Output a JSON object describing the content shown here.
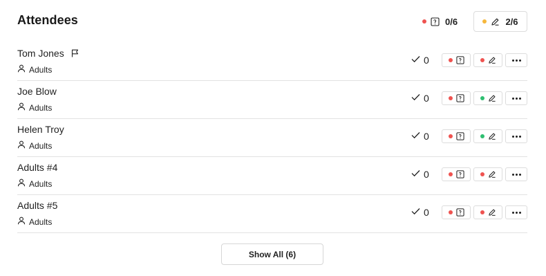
{
  "header": {
    "title": "Attendees",
    "forms_summary": {
      "count": "0/6",
      "status": "red",
      "icon": "form-icon"
    },
    "waivers_summary": {
      "count": "2/6",
      "status": "orange",
      "icon": "pencil-icon"
    }
  },
  "colors": {
    "red": "#ef5350",
    "orange": "#f6b73c",
    "green": "#2fbf71"
  },
  "attendees": [
    {
      "name": "Tom Jones",
      "flagged": true,
      "group": "Adults",
      "checkins": "0",
      "form_status": "red",
      "waiver_status": "red"
    },
    {
      "name": "Joe Blow",
      "flagged": false,
      "group": "Adults",
      "checkins": "0",
      "form_status": "red",
      "waiver_status": "green"
    },
    {
      "name": "Helen Troy",
      "flagged": false,
      "group": "Adults",
      "checkins": "0",
      "form_status": "red",
      "waiver_status": "green"
    },
    {
      "name": "Adults #4",
      "flagged": false,
      "group": "Adults",
      "checkins": "0",
      "form_status": "red",
      "waiver_status": "red"
    },
    {
      "name": "Adults #5",
      "flagged": false,
      "group": "Adults",
      "checkins": "0",
      "form_status": "red",
      "waiver_status": "red"
    }
  ],
  "footer": {
    "show_all_label": "Show All (6)"
  }
}
